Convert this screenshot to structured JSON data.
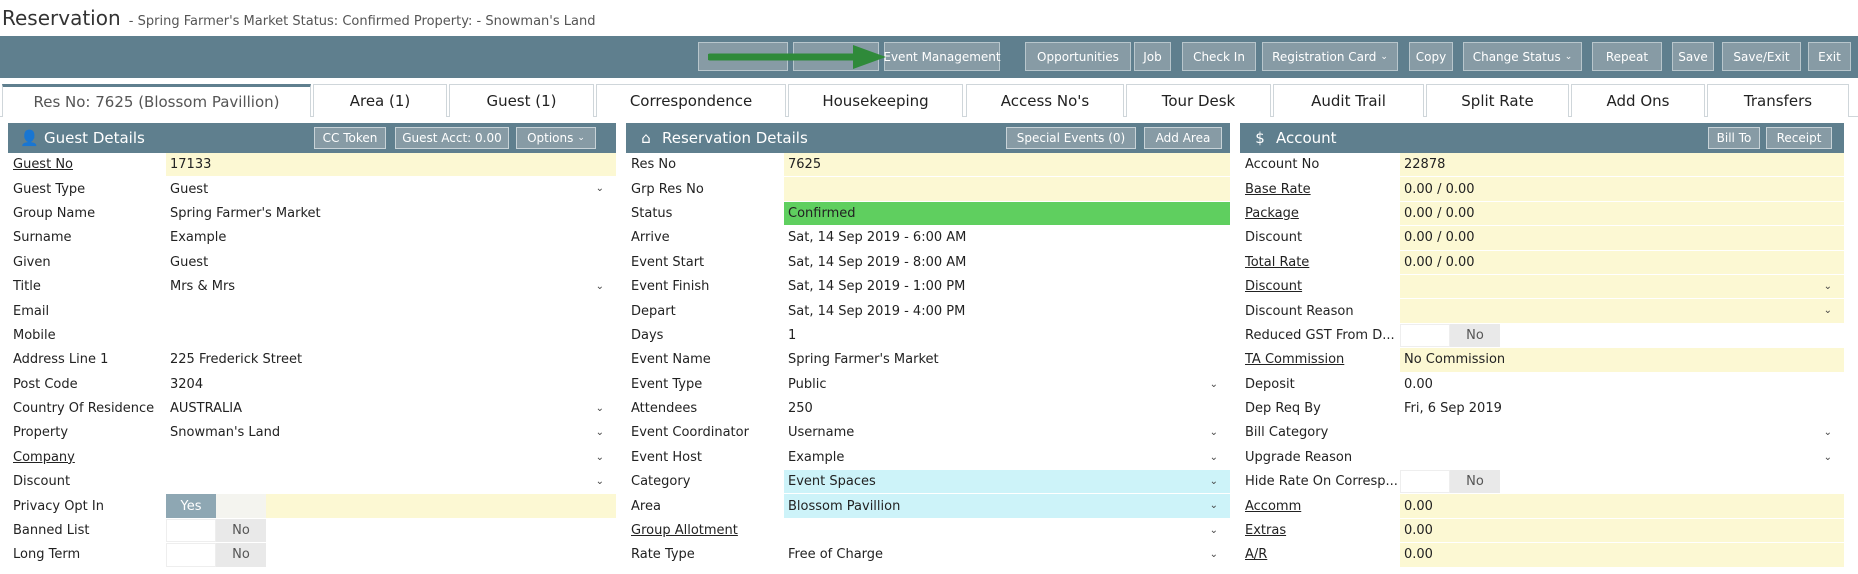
{
  "title": {
    "app": "Reservation",
    "subtitle": "- Spring Farmer's Market    Status: Confirmed  Property: - Snowman's Land"
  },
  "toolbar": {
    "buttons": [
      {
        "label": "",
        "caret": false
      },
      {
        "label": "",
        "caret": false
      },
      {
        "label": "Event Management",
        "caret": false
      },
      {
        "label": "Opportunities",
        "caret": false
      },
      {
        "label": "Job",
        "caret": false
      },
      {
        "label": "Check In",
        "caret": false
      },
      {
        "label": "Registration Card",
        "caret": true
      },
      {
        "label": "Copy",
        "caret": false
      },
      {
        "label": "Change Status",
        "caret": true
      },
      {
        "label": "Repeat",
        "caret": false
      },
      {
        "label": "Save",
        "caret": false
      },
      {
        "label": "Save/Exit",
        "caret": false
      },
      {
        "label": "Exit",
        "caret": false
      }
    ]
  },
  "tabs": [
    "Res No: 7625 (Blossom Pavillion)",
    "Area (1)",
    "Guest (1)",
    "Correspondence",
    "Housekeeping",
    "Access No's",
    "Tour Desk",
    "Audit Trail",
    "Split Rate",
    "Add Ons",
    "Transfers"
  ],
  "guest": {
    "title": "Guest Details",
    "icon": "user-icon",
    "buttons": [
      "CC Token",
      "Guest Acct: 0.00",
      "Options"
    ],
    "rows": [
      {
        "label": "Guest No",
        "value": "17133",
        "u": true,
        "bg": "y",
        "chev": false
      },
      {
        "label": "Guest Type",
        "value": "Guest",
        "u": false,
        "bg": "",
        "chev": true
      },
      {
        "label": "Group Name",
        "value": "Spring Farmer's Market",
        "u": false,
        "bg": "",
        "chev": false
      },
      {
        "label": "Surname",
        "value": "Example",
        "u": false,
        "bg": "",
        "chev": false
      },
      {
        "label": "Given",
        "value": "Guest",
        "u": false,
        "bg": "",
        "chev": false
      },
      {
        "label": "Title",
        "value": "Mrs & Mrs",
        "u": false,
        "bg": "",
        "chev": true
      },
      {
        "label": "Email",
        "value": "",
        "u": false,
        "bg": "",
        "chev": false
      },
      {
        "label": "Mobile",
        "value": "",
        "u": false,
        "bg": "",
        "chev": false
      },
      {
        "label": "Address Line 1",
        "value": "225 Frederick Street",
        "u": false,
        "bg": "",
        "chev": false
      },
      {
        "label": "Post Code",
        "value": "3204",
        "u": false,
        "bg": "",
        "chev": false
      },
      {
        "label": "Country Of Residence",
        "value": "AUSTRALIA",
        "u": false,
        "bg": "",
        "chev": true
      },
      {
        "label": "Property",
        "value": "Snowman's Land",
        "u": false,
        "bg": "",
        "chev": true
      },
      {
        "label": "Company",
        "value": "",
        "u": true,
        "bg": "",
        "chev": true
      },
      {
        "label": "Discount",
        "value": "",
        "u": false,
        "bg": "",
        "chev": true
      },
      {
        "label": "Privacy Opt In",
        "toggle": "Yes",
        "u": false
      },
      {
        "label": "Banned List",
        "toggle": "No",
        "u": false
      },
      {
        "label": "Long Term",
        "toggle": "No",
        "u": false
      }
    ]
  },
  "reservation": {
    "title": "Reservation Details",
    "icon": "home-icon",
    "buttons": [
      "Special Events (0)",
      "Add Area"
    ],
    "rows": [
      {
        "label": "Res No",
        "value": "7625",
        "u": false,
        "bg": "y",
        "chev": false
      },
      {
        "label": "Grp Res No",
        "value": "",
        "u": false,
        "bg": "y",
        "chev": false
      },
      {
        "label": "Status",
        "value": "Confirmed",
        "u": false,
        "bg": "g",
        "chev": false
      },
      {
        "label": "Arrive",
        "value": "Sat, 14 Sep 2019 - 6:00 AM",
        "u": false,
        "bg": "",
        "chev": false
      },
      {
        "label": "Event Start",
        "value": "Sat, 14 Sep 2019 - 8:00 AM",
        "u": false,
        "bg": "",
        "chev": false
      },
      {
        "label": "Event Finish",
        "value": "Sat, 14 Sep 2019 - 1:00 PM",
        "u": false,
        "bg": "",
        "chev": false
      },
      {
        "label": "Depart",
        "value": "Sat, 14 Sep 2019 - 4:00 PM",
        "u": false,
        "bg": "",
        "chev": false
      },
      {
        "label": "Days",
        "value": "1",
        "u": false,
        "bg": "",
        "chev": false
      },
      {
        "label": "Event Name",
        "value": "Spring Farmer's Market",
        "u": false,
        "bg": "",
        "chev": false
      },
      {
        "label": "Event Type",
        "value": "Public",
        "u": false,
        "bg": "",
        "chev": true
      },
      {
        "label": "Attendees",
        "value": "250",
        "u": false,
        "bg": "",
        "chev": false
      },
      {
        "label": "Event Coordinator",
        "value": "Username",
        "u": false,
        "bg": "",
        "chev": true
      },
      {
        "label": "Event Host",
        "value": "Example",
        "u": false,
        "bg": "",
        "chev": true
      },
      {
        "label": "Category",
        "value": "Event Spaces",
        "u": false,
        "bg": "b",
        "chev": true
      },
      {
        "label": "Area",
        "value": "Blossom Pavillion",
        "u": false,
        "bg": "b",
        "chev": true
      },
      {
        "label": "Group Allotment",
        "value": "",
        "u": true,
        "bg": "",
        "chev": true
      },
      {
        "label": "Rate Type",
        "value": "Free of Charge",
        "u": false,
        "bg": "",
        "chev": true
      }
    ]
  },
  "account": {
    "title": "Account",
    "icon": "dollar-icon",
    "buttons": [
      "Bill To",
      "Receipt"
    ],
    "rows": [
      {
        "label": "Account No",
        "value": "22878",
        "u": false,
        "bg": "y",
        "chev": false
      },
      {
        "label": "Base Rate",
        "value": "0.00 / 0.00",
        "u": true,
        "bg": "y",
        "chev": false
      },
      {
        "label": "Package",
        "value": "0.00 / 0.00",
        "u": true,
        "bg": "y",
        "chev": false
      },
      {
        "label": "Discount",
        "value": "0.00 / 0.00",
        "u": false,
        "bg": "y",
        "chev": false
      },
      {
        "label": "Total Rate",
        "value": "0.00 / 0.00",
        "u": true,
        "bg": "y",
        "chev": false
      },
      {
        "label": "Discount",
        "value": "",
        "u": true,
        "bg": "y",
        "chev": true
      },
      {
        "label": "Discount Reason",
        "value": "",
        "u": false,
        "bg": "y",
        "chev": true
      },
      {
        "label": "Reduced GST From D...",
        "toggle": "No",
        "u": false
      },
      {
        "label": "TA Commission",
        "value": "No Commission",
        "u": true,
        "bg": "y",
        "chev": false
      },
      {
        "label": "Deposit",
        "value": "0.00",
        "u": false,
        "bg": "",
        "chev": false
      },
      {
        "label": "Dep Req By",
        "value": "Fri, 6 Sep 2019",
        "u": false,
        "bg": "",
        "chev": false
      },
      {
        "label": "Bill Category",
        "value": "",
        "u": false,
        "bg": "",
        "chev": true
      },
      {
        "label": "Upgrade Reason",
        "value": "",
        "u": false,
        "bg": "",
        "chev": true
      },
      {
        "label": "Hide Rate On Corresp...",
        "toggle": "No",
        "u": false
      },
      {
        "label": "Accomm",
        "value": "0.00",
        "u": true,
        "bg": "y",
        "chev": false
      },
      {
        "label": "Extras",
        "value": "0.00",
        "u": true,
        "bg": "y",
        "chev": false
      },
      {
        "label": "A/R",
        "value": "0.00",
        "u": true,
        "bg": "y",
        "chev": false
      }
    ]
  },
  "colors": {
    "header": "#5f7f8e",
    "button": "#879ba5",
    "yellow": "#fcf8d3",
    "green": "#5fcf5f",
    "cyan": "#cdf3f9",
    "arrow": "#2f8a3a"
  }
}
